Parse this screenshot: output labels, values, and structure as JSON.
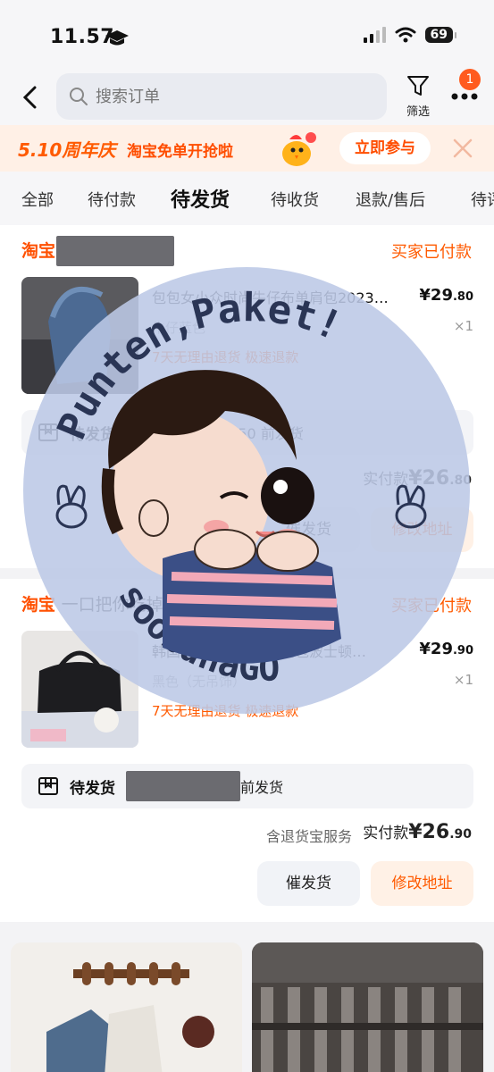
{
  "status_bar": {
    "time": "11.57",
    "battery": "69"
  },
  "search": {
    "placeholder": "搜索订单"
  },
  "header": {
    "filter_label": "筛选",
    "badge_count": "1"
  },
  "promo": {
    "tag": "5.10周年庆",
    "text": "淘宝免单开抢啦",
    "join_label": "立即参与"
  },
  "tabs": [
    {
      "label": "全部"
    },
    {
      "label": "待付款"
    },
    {
      "label": "待发货",
      "active": true
    },
    {
      "label": "待收货"
    },
    {
      "label": "退款/售后"
    },
    {
      "label": "待评"
    }
  ],
  "orders": [
    {
      "platform": "淘宝",
      "shop_name": "",
      "status": "买家已付款",
      "title": "包包女小众时尚牛仔布单肩包2023…",
      "price_main": "¥29",
      "price_cents": ".80",
      "sku": "牛仔蓝色",
      "qty": "×1",
      "tags": "7天无理由退货  极速退款",
      "ship_status": "待发货",
      "ship_promise": "承诺 5月11日12:50 前发货",
      "paid_label": "实付款",
      "paid_main": "¥26",
      "paid_cents": ".80",
      "service": "",
      "btn_urge": "催发货",
      "btn_address": "修改地址"
    },
    {
      "platform": "淘宝",
      "shop_name": "一口把你吃掉女包店",
      "status": "买家已付款",
      "title": "韩国明星同款保龄球包包波士顿…",
      "price_main": "¥29",
      "price_cents": ".90",
      "sku": "黑色（无吊饰）",
      "qty": "×1",
      "tags": "7天无理由退货  极速退款",
      "ship_status": "待发货",
      "ship_promise": "前发货",
      "paid_label": "实付款",
      "paid_main": "¥26",
      "paid_cents": ".90",
      "service": "含退货宝服务",
      "btn_urge": "催发货",
      "btn_address": "修改地址"
    }
  ],
  "sticker": {
    "top_text": "Punten,Paket!",
    "bottom_text": "soobunaGO"
  },
  "colors": {
    "accent": "#ff5a00",
    "sticker_bg": "#bcc8e6"
  }
}
